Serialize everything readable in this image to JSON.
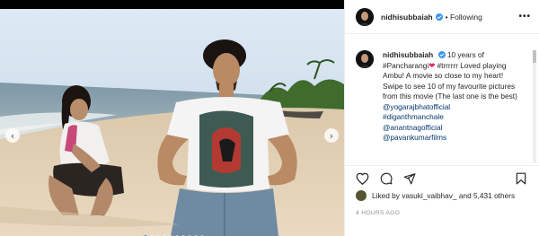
{
  "post": {
    "username": "nidhisubbaiah",
    "follow_label": "• Following",
    "more_label": "•••",
    "caption": {
      "username": "nidhisubbaiah",
      "text": "10 years of #Pancharangi",
      "text2": "#trrrrrr Loved playing Ambu! A movie so close to my heart!",
      "text3": "Swipe to see 10 of my favourite pictures from this movie (The last one is the best)",
      "mentions": [
        "@yogarajbhatofficial",
        "#diganthmanchale",
        "@anantnagofficial",
        "@pavankumarfilms"
      ]
    },
    "likes_label": "Liked by vasuki_vaibhav_ and 5,431 others",
    "time_ago": "4 HOURS AGO"
  },
  "icons": {
    "heart": "heart-icon",
    "comment": "comment-icon",
    "share": "share-icon",
    "save": "bookmark-icon",
    "verified": "verified-badge-icon",
    "prev": "chevron-left-icon",
    "next": "chevron-right-icon"
  },
  "carousel": {
    "slide_count": 10,
    "active_slide": 1
  },
  "colors": {
    "link": "#00376b",
    "verified": "#3897f0",
    "heart_emoji": "#e0245e"
  }
}
